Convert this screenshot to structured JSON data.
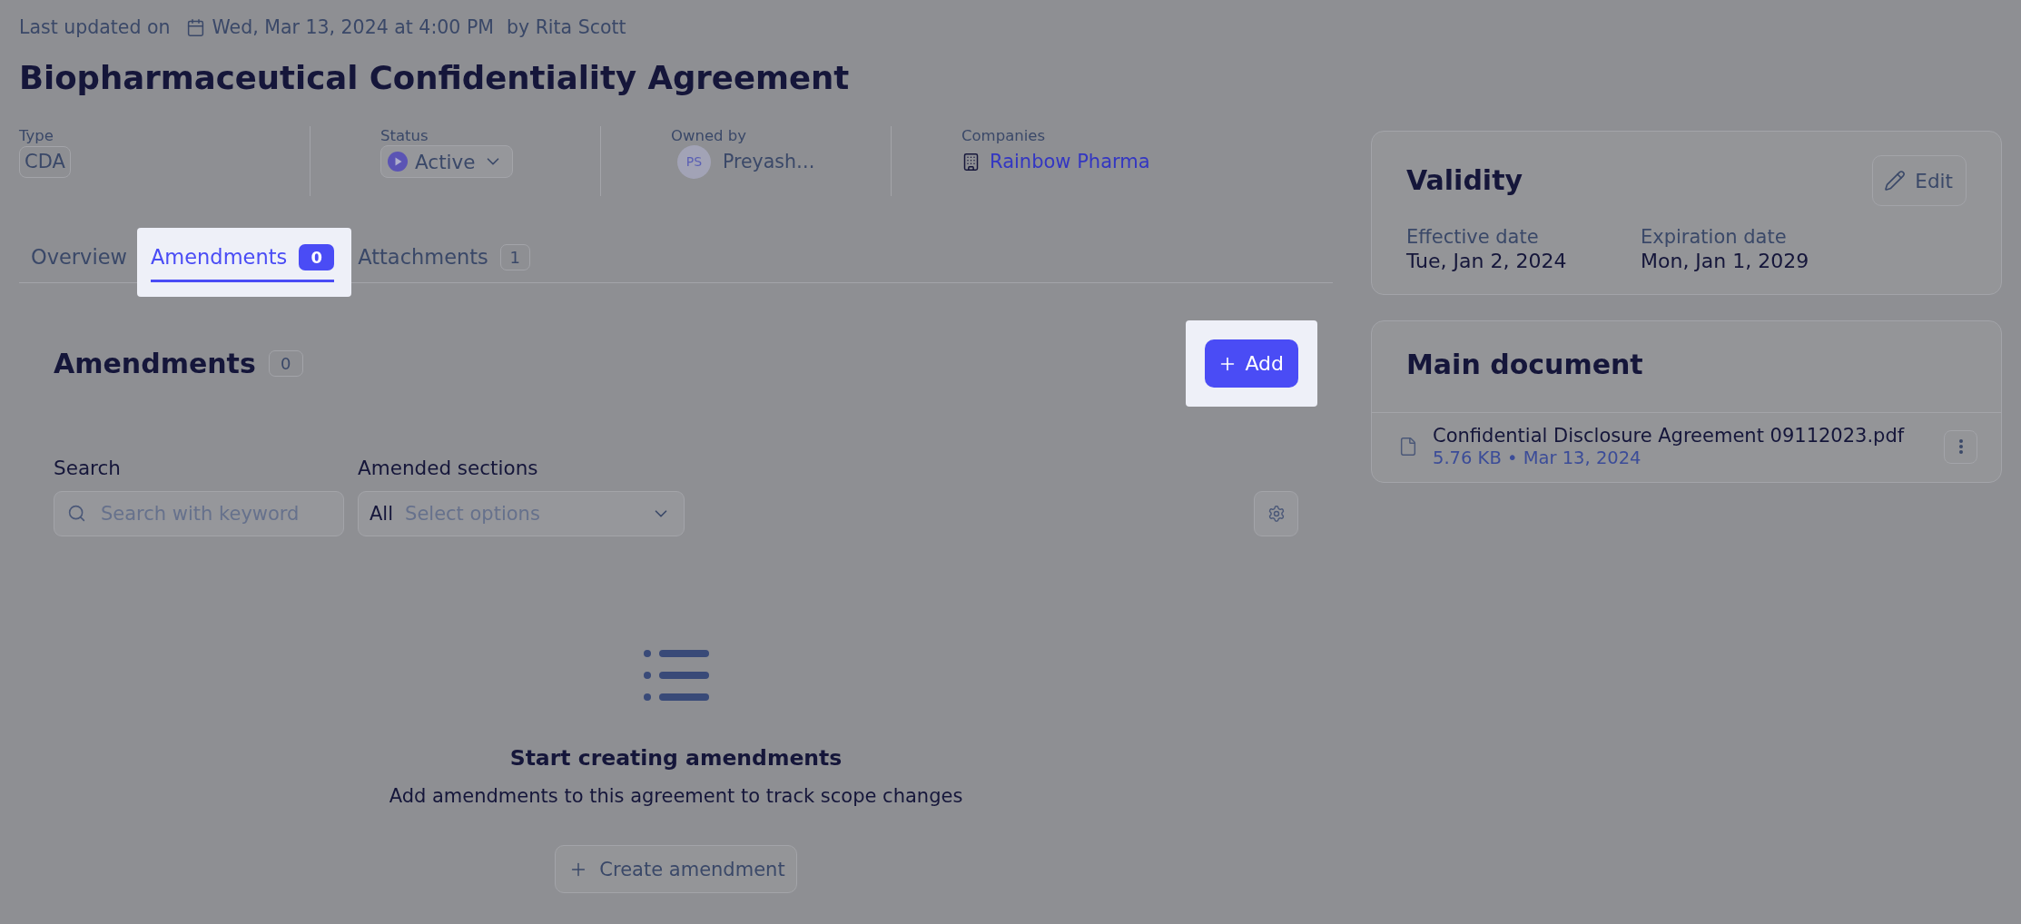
{
  "header": {
    "updated_label": "Last updated on",
    "updated_date": "Wed, Mar 13, 2024 at 4:00 PM",
    "updated_by": "by Rita Scott",
    "title": "Biopharmaceutical Confidentiality Agreement"
  },
  "meta": [
    {
      "kind": "chip",
      "label": "Type",
      "value": "CDA"
    },
    {
      "kind": "status",
      "label": "Status",
      "value": "Active"
    },
    {
      "kind": "owner",
      "label": "Owned by",
      "initials": "PS",
      "value": "Preyash…"
    },
    {
      "kind": "link",
      "label": "Companies",
      "value": "Rainbow Pharma"
    }
  ],
  "tabs": [
    {
      "label": "Overview",
      "selected": false,
      "spotlight": false
    },
    {
      "label": "Amendments",
      "count": "0",
      "selected": true,
      "spotlight": true
    },
    {
      "label": "Attachments",
      "count": "1",
      "selected": false,
      "spotlight": false
    }
  ],
  "amendments": {
    "title": "Amendments",
    "count": "0",
    "add_button": {
      "label": "Add",
      "spotlight": true
    },
    "filters": [
      {
        "kind": "search",
        "label": "Search",
        "placeholder": "Search with keyword"
      },
      {
        "kind": "select",
        "label": "Amended sections",
        "prefix": "All",
        "placeholder": "Select options"
      }
    ],
    "empty_state": {
      "title": "Start creating amendments",
      "text": "Add amendments to this agreement to track scope changes",
      "button": "Create amendment"
    }
  },
  "validity": {
    "title": "Validity",
    "edit_button": "Edit",
    "dates": [
      {
        "label": "Effective date",
        "value": "Tue, Jan 2, 2024"
      },
      {
        "label": "Expiration date",
        "value": "Mon, Jan 1, 2029"
      }
    ]
  },
  "main_document": {
    "title": "Main document",
    "file": {
      "name": "Confidential Disclosure Agreement 09112023.pdf",
      "details": "5.76 KB • Mar 13, 2024"
    }
  }
}
